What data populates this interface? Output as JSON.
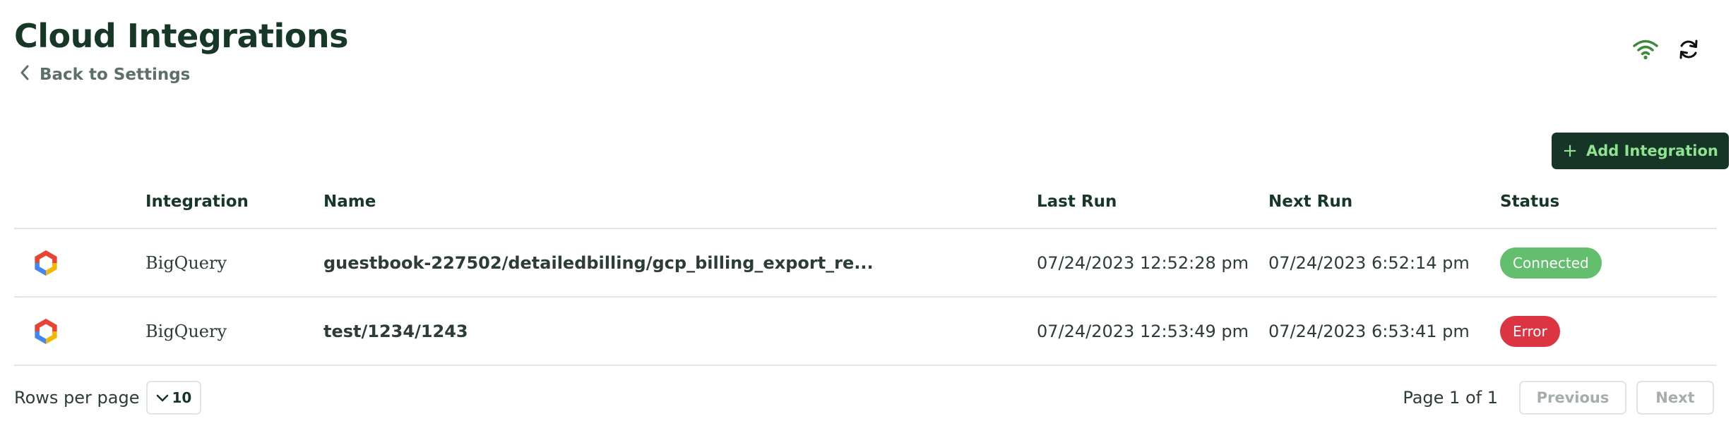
{
  "header": {
    "title": "Cloud Integrations",
    "back_label": "Back to Settings",
    "icons": [
      "wifi-icon",
      "refresh-icon"
    ],
    "wifi_color": "#3a8a3a"
  },
  "toolbar": {
    "add_label": "Add Integration"
  },
  "table": {
    "columns": [
      "",
      "Integration",
      "Name",
      "Last Run",
      "Next Run",
      "Status"
    ],
    "rows": [
      {
        "icon": "google-cloud-logo-icon",
        "integration": "BigQuery",
        "name": "guestbook-227502/detailedbilling/gcp_billing_export_re...",
        "last_run": "07/24/2023 12:52:28 pm",
        "next_run": "07/24/2023 6:52:14 pm",
        "status": "Connected",
        "status_color": "#63be6e"
      },
      {
        "icon": "google-cloud-logo-icon",
        "integration": "BigQuery",
        "name": "test/1234/1243",
        "last_run": "07/24/2023 12:53:49 pm",
        "next_run": "07/24/2023 6:53:41 pm",
        "status": "Error",
        "status_color": "#db3544"
      }
    ]
  },
  "footer": {
    "rows_per_page_label": "Rows per page",
    "rows_per_page_value": "10",
    "page_info": "Page 1 of 1",
    "previous_label": "Previous",
    "next_label": "Next"
  },
  "colors": {
    "primary_dark": "#163526",
    "accent_green": "#8ee290"
  }
}
